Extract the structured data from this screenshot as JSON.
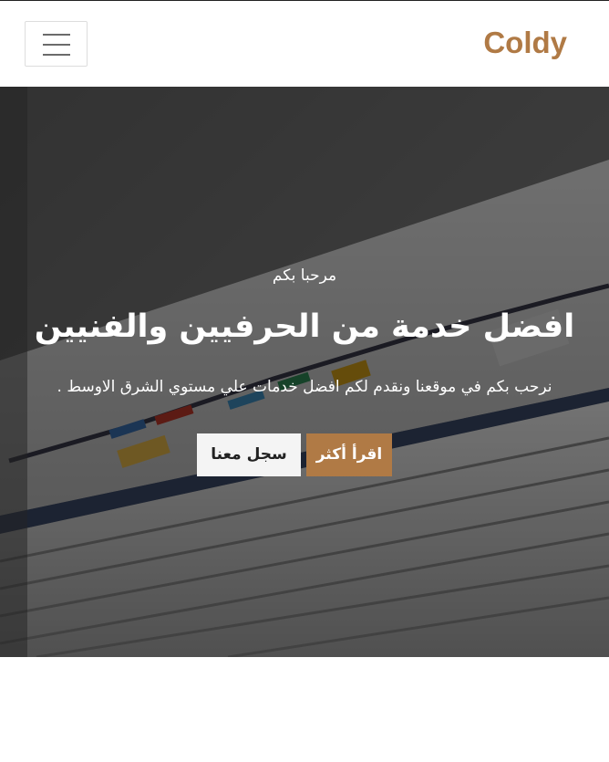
{
  "colors": {
    "brand": "#b07a45",
    "accent": "#b07a45"
  },
  "navbar": {
    "brand": "Coldy",
    "menu_icon": "hamburger-menu-icon"
  },
  "hero": {
    "kicker": "مرحبا بكم",
    "title": "افضل خدمة من الحرفيين والفنيين",
    "text": "نرحب بكم في موقعنا ونقدم لكم افضل خدمات علي مستوي الشرق الاوسط .",
    "buttons": {
      "read_more": "اقرأ أكثر",
      "register": "سجل معنا"
    }
  }
}
